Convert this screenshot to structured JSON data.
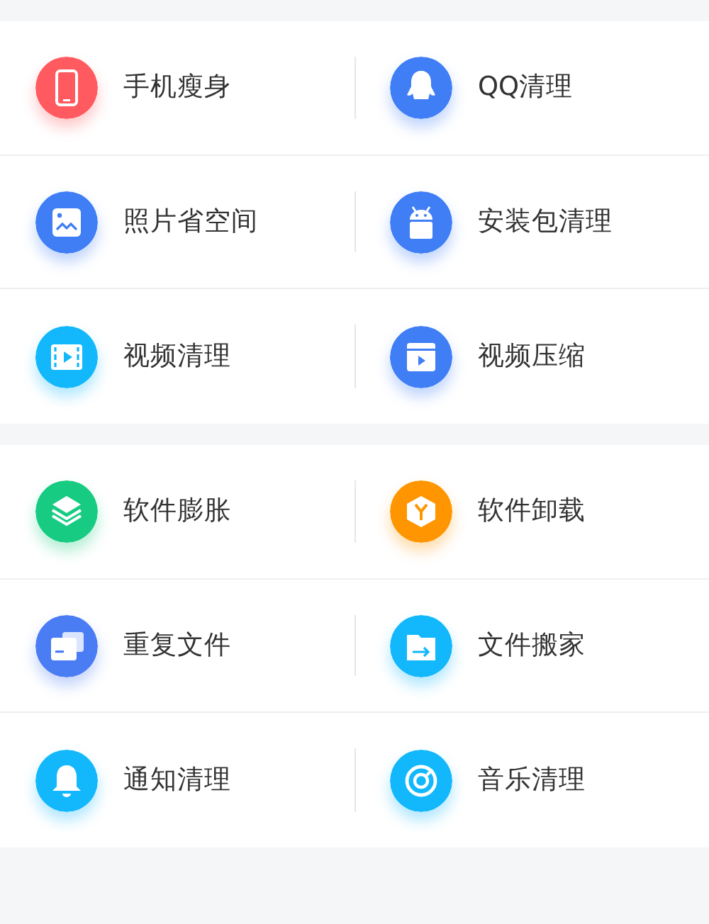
{
  "sections": [
    {
      "items": [
        {
          "label": "手机瘦身",
          "kind": "phone",
          "color": "#ff5a5f"
        },
        {
          "label": "QQ清理",
          "kind": "penguin",
          "color": "#3f7ef5"
        },
        {
          "label": "照片省空间",
          "kind": "image",
          "color": "#3f7ef5"
        },
        {
          "label": "安装包清理",
          "kind": "android",
          "color": "#3f7ef5"
        },
        {
          "label": "视频清理",
          "kind": "film",
          "color": "#12b8fb"
        },
        {
          "label": "视频压缩",
          "kind": "video",
          "color": "#3f7ef5"
        }
      ]
    },
    {
      "items": [
        {
          "label": "软件膨胀",
          "kind": "layers",
          "color": "#17cc82"
        },
        {
          "label": "软件卸载",
          "kind": "cube",
          "color": "#ff9500"
        },
        {
          "label": "重复文件",
          "kind": "cards",
          "color": "#4a7cf4"
        },
        {
          "label": "文件搬家",
          "kind": "folder",
          "color": "#12b8fb"
        },
        {
          "label": "通知清理",
          "kind": "bell",
          "color": "#12b8fb"
        },
        {
          "label": "音乐清理",
          "kind": "disc",
          "color": "#12b8fb"
        }
      ]
    }
  ]
}
